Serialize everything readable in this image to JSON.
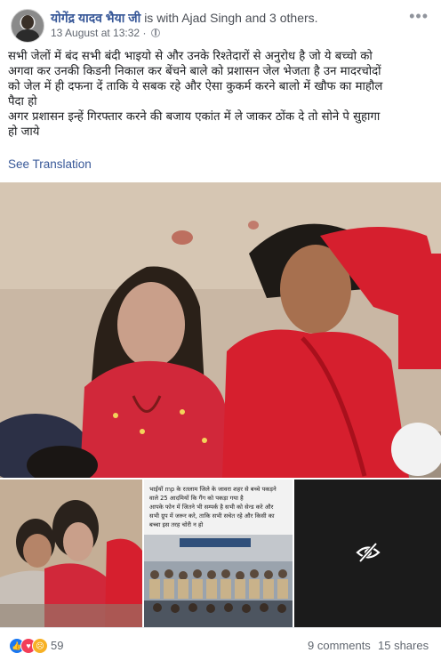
{
  "header": {
    "author": "योगेंद्र यादव भैया जी",
    "with_text": "is with Ajad Singh and 3 others.",
    "timestamp": "13 August at 13:32",
    "separator": "·",
    "privacy_icon": "globe-icon",
    "more_icon": "more-options-icon",
    "more_symbol": "•••"
  },
  "post": {
    "lines": [
      "सभी जेलों में बंद सभी बंदी भाइयो से और उनके रिश्तेदारों से अनुरोध है जो ये बच्चो को",
      "अगवा कर उनकी किडनी निकाल कर बेंचने बाले को प्रशासन जेल भेजता है उन मादरचोदों",
      "को जेल में ही दफना दें ताकि ये सबक रहे और ऐसा कुकर्म करने बालो में खौफ का माहौल",
      "पैदा हो",
      "अगर प्रशासन इन्हें गिरफ्तार करने की बजाय एकांत में ले जाकर ठोंक दे तो सोने पे सुहागा",
      "हो जाये"
    ],
    "see_translation": "See Translation"
  },
  "news_image": {
    "lines": [
      "भाईयों mp के रतलाम जिले के जावरा शहर से बच्चे पकड़ने",
      "वाले 25 आदमियों कि गैंग को पकड़ा गया है",
      "आपके फोन में जितने भी सम्पर्क है सभी को सेन्ड करे और",
      "सभी ग्रुप में जरूर करे, ताकि सभी सचेत रहे और किसी का",
      "बच्चा इस तरह चोरी न हो"
    ]
  },
  "hidden_media_icon": "eye-slash-icon",
  "footer": {
    "reaction_icons": [
      "like-icon",
      "love-icon",
      "sad-icon"
    ],
    "reaction_count": "59",
    "comments": "9 comments",
    "shares": "15 shares"
  },
  "colors": {
    "link": "#385898",
    "meta": "#616770",
    "like": "#1877f2",
    "love": "#f33e58",
    "sad": "#f7b125"
  }
}
